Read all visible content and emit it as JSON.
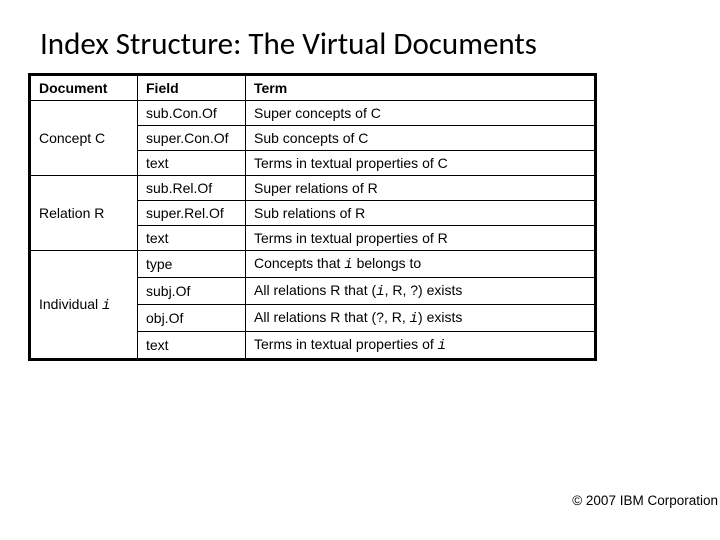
{
  "title": "Index Structure: The Virtual Documents",
  "headers": {
    "document": "Document",
    "field": "Field",
    "term": "Term"
  },
  "groups": [
    {
      "doc_prefix": "Concept ",
      "doc_var": "C",
      "rows": [
        {
          "field": "sub.Con.Of",
          "term": "Super concepts of C"
        },
        {
          "field": "super.Con.Of",
          "term": "Sub concepts of C"
        },
        {
          "field": "text",
          "term": "Terms in textual properties of C"
        }
      ]
    },
    {
      "doc_prefix": "Relation ",
      "doc_var": "R",
      "rows": [
        {
          "field": "sub.Rel.Of",
          "term": "Super relations of R"
        },
        {
          "field": "super.Rel.Of",
          "term": "Sub relations of R"
        },
        {
          "field": "text",
          "term": "Terms in textual properties of R"
        }
      ]
    },
    {
      "doc_prefix": "Individual ",
      "doc_var": "i",
      "doc_var_mono": true,
      "rows": [
        {
          "field": "type",
          "term_parts": [
            "Concepts that ",
            {
              "mono": "i"
            },
            "  belongs to"
          ]
        },
        {
          "field": "subj.Of",
          "term_parts": [
            "All relations R that (",
            {
              "mono": "i"
            },
            ", R, ?) exists"
          ]
        },
        {
          "field": "obj.Of",
          "term_parts": [
            "All relations R that (?, R, ",
            {
              "mono": "i"
            },
            ") exists"
          ]
        },
        {
          "field": "text",
          "term_parts": [
            "Terms in textual properties of ",
            {
              "mono": "i"
            }
          ]
        }
      ]
    }
  ],
  "copyright": "© 2007 IBM Corporation"
}
